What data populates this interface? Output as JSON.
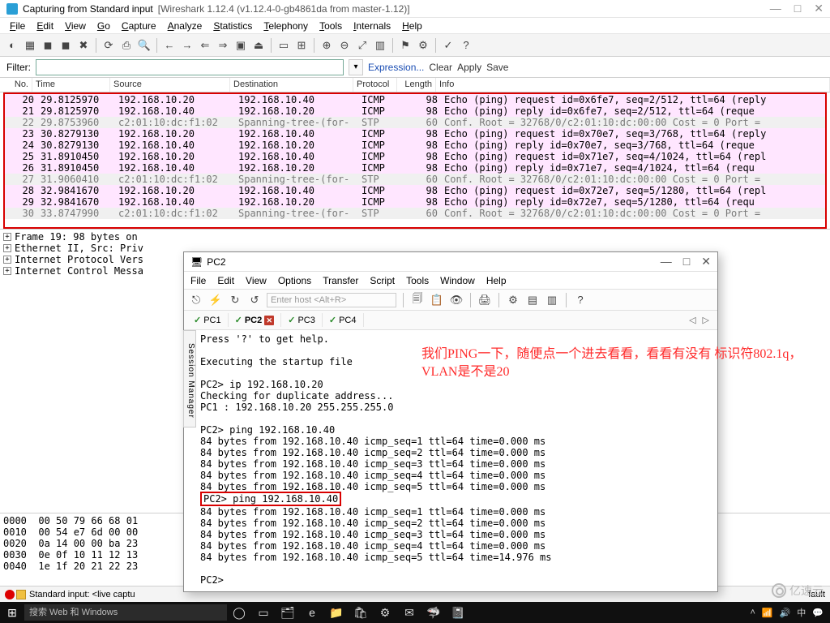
{
  "ws": {
    "title_prefix": "Capturing from ",
    "capture_source": "Standard input",
    "app_subtitle": "[Wireshark 1.12.4  (v1.12.4-0-gb4861da from master-1.12)]",
    "menu": [
      "File",
      "Edit",
      "View",
      "Go",
      "Capture",
      "Analyze",
      "Statistics",
      "Telephony",
      "Tools",
      "Internals",
      "Help"
    ],
    "filter_label": "Filter:",
    "filter_value": "",
    "expression_link": "Expression...",
    "clear_link": "Clear",
    "apply_link": "Apply",
    "save_link": "Save",
    "columns": [
      "No.",
      "Time",
      "Source",
      "Destination",
      "Protocol",
      "Length",
      "Info"
    ],
    "packets": [
      {
        "no": "20",
        "time": "29.8125970",
        "src": "192.168.10.20",
        "dst": "192.168.10.40",
        "proto": "ICMP",
        "len": "98",
        "info": "Echo (ping) request  id=0x6fe7, seq=2/512, ttl=64 (reply",
        "cls": "pink"
      },
      {
        "no": "21",
        "time": "29.8125970",
        "src": "192.168.10.40",
        "dst": "192.168.10.20",
        "proto": "ICMP",
        "len": "98",
        "info": "Echo (ping) reply    id=0x6fe7, seq=2/512, ttl=64 (reque",
        "cls": "pink"
      },
      {
        "no": "22",
        "time": "29.8753960",
        "src": "c2:01:10:dc:f1:02",
        "dst": "Spanning-tree-(for-",
        "proto": "STP",
        "len": "60",
        "info": "Conf. Root = 32768/0/c2:01:10:dc:00:00  Cost = 0  Port =",
        "cls": "grey"
      },
      {
        "no": "23",
        "time": "30.8279130",
        "src": "192.168.10.20",
        "dst": "192.168.10.40",
        "proto": "ICMP",
        "len": "98",
        "info": "Echo (ping) request  id=0x70e7, seq=3/768, ttl=64 (reply",
        "cls": "pink"
      },
      {
        "no": "24",
        "time": "30.8279130",
        "src": "192.168.10.40",
        "dst": "192.168.10.20",
        "proto": "ICMP",
        "len": "98",
        "info": "Echo (ping) reply    id=0x70e7, seq=3/768, ttl=64 (reque",
        "cls": "pink"
      },
      {
        "no": "25",
        "time": "31.8910450",
        "src": "192.168.10.20",
        "dst": "192.168.10.40",
        "proto": "ICMP",
        "len": "98",
        "info": "Echo (ping) request  id=0x71e7, seq=4/1024, ttl=64 (repl",
        "cls": "pink"
      },
      {
        "no": "26",
        "time": "31.8910450",
        "src": "192.168.10.40",
        "dst": "192.168.10.20",
        "proto": "ICMP",
        "len": "98",
        "info": "Echo (ping) reply    id=0x71e7, seq=4/1024, ttl=64 (requ",
        "cls": "pink"
      },
      {
        "no": "27",
        "time": "31.9060410",
        "src": "c2:01:10:dc:f1:02",
        "dst": "Spanning-tree-(for-",
        "proto": "STP",
        "len": "60",
        "info": "Conf. Root = 32768/0/c2:01:10:dc:00:00  Cost = 0  Port =",
        "cls": "grey"
      },
      {
        "no": "28",
        "time": "32.9841670",
        "src": "192.168.10.20",
        "dst": "192.168.10.40",
        "proto": "ICMP",
        "len": "98",
        "info": "Echo (ping) request  id=0x72e7, seq=5/1280, ttl=64 (repl",
        "cls": "pink"
      },
      {
        "no": "29",
        "time": "32.9841670",
        "src": "192.168.10.40",
        "dst": "192.168.10.20",
        "proto": "ICMP",
        "len": "98",
        "info": "Echo (ping) reply    id=0x72e7, seq=5/1280, ttl=64 (requ",
        "cls": "pink"
      },
      {
        "no": "30",
        "time": "33.8747990",
        "src": "c2:01:10:dc:f1:02",
        "dst": "Spanning-tree-(for-",
        "proto": "STP",
        "len": "60",
        "info": "Conf. Root = 32768/0/c2:01:10:dc:00:00  Cost = 0  Port =",
        "cls": "grey"
      }
    ],
    "details": [
      "Frame 19: 98 bytes on ",
      "Ethernet II, Src: Priv",
      "Internet Protocol Vers",
      "Internet Control Messa"
    ],
    "hex": "0000  00 50 79 66 68 01\n0010  00 54 e7 6d 00 00\n0020  0a 14 00 00 ba 23\n0030  0e 0f 10 11 12 13\n0040  1e 1f 20 21 22 23",
    "status_text": "Standard input: <live captu",
    "status_right": "fault"
  },
  "pc2": {
    "title": "PC2",
    "title_icon": "🖥",
    "menu": [
      "File",
      "Edit",
      "View",
      "Options",
      "Transfer",
      "Script",
      "Tools",
      "Window",
      "Help"
    ],
    "host_placeholder": "Enter host <Alt+R>",
    "tabs": [
      {
        "label": "PC1",
        "active": false
      },
      {
        "label": "PC2",
        "active": true,
        "closable": true
      },
      {
        "label": "PC3",
        "active": false
      },
      {
        "label": "PC4",
        "active": false
      }
    ],
    "session_label": "Session Manager",
    "terminal": "Press '?' to get help.\n\nExecuting the startup file\n\nPC2> ip 192.168.10.20\nChecking for duplicate address...\nPC1 : 192.168.10.20 255.255.255.0\n\nPC2> ping 192.168.10.40\n84 bytes from 192.168.10.40 icmp_seq=1 ttl=64 time=0.000 ms\n84 bytes from 192.168.10.40 icmp_seq=2 ttl=64 time=0.000 ms\n84 bytes from 192.168.10.40 icmp_seq=3 ttl=64 time=0.000 ms\n84 bytes from 192.168.10.40 icmp_seq=4 ttl=64 time=0.000 ms\n84 bytes from 192.168.10.40 icmp_seq=5 ttl=64 time=0.000 ms\n",
    "terminal_boxed": "PC2> ping 192.168.10.40",
    "terminal_after": "84 bytes from 192.168.10.40 icmp_seq=1 ttl=64 time=0.000 ms\n84 bytes from 192.168.10.40 icmp_seq=2 ttl=64 time=0.000 ms\n84 bytes from 192.168.10.40 icmp_seq=3 ttl=64 time=0.000 ms\n84 bytes from 192.168.10.40 icmp_seq=4 ttl=64 time=0.000 ms\n84 bytes from 192.168.10.40 icmp_seq=5 ttl=64 time=14.976 ms\n\nPC2>"
  },
  "annotation": "我们PING一下，随便点一个进去看看，看看有没有\n标识符802.1q，VLAN是不是20",
  "taskbar": {
    "search_placeholder": "搜索 Web 和 Windows",
    "icons": [
      "◯",
      "▭",
      "🗂",
      "e",
      "📁",
      "🛍",
      "⚙",
      "✉",
      "🦈",
      "📓"
    ]
  },
  "watermark": "亿速云",
  "toolbar_icons": [
    "◐",
    "▦",
    "◼",
    "◼",
    "✖",
    "⟳",
    "⎙",
    "🔍",
    "←",
    "→",
    "⇐",
    "⇒",
    "▣",
    "⏏",
    "▭",
    "⊞",
    "⊕",
    "⊖",
    "⤢",
    "▥",
    "⚑",
    "⚙",
    "✓",
    "?"
  ]
}
